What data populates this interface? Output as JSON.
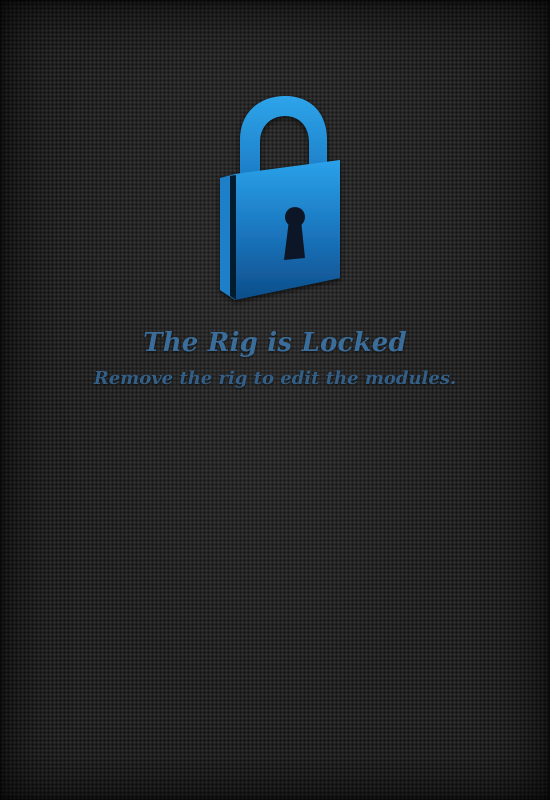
{
  "lock_screen": {
    "icon": "padlock-icon",
    "title": "The Rig is Locked",
    "message": "Remove the rig to edit the modules."
  },
  "colors": {
    "lock_blue_light": "#2a9fe6",
    "lock_blue_dark": "#0e4f8c",
    "text_blue": "#3b6d9a",
    "background": "#222222"
  }
}
